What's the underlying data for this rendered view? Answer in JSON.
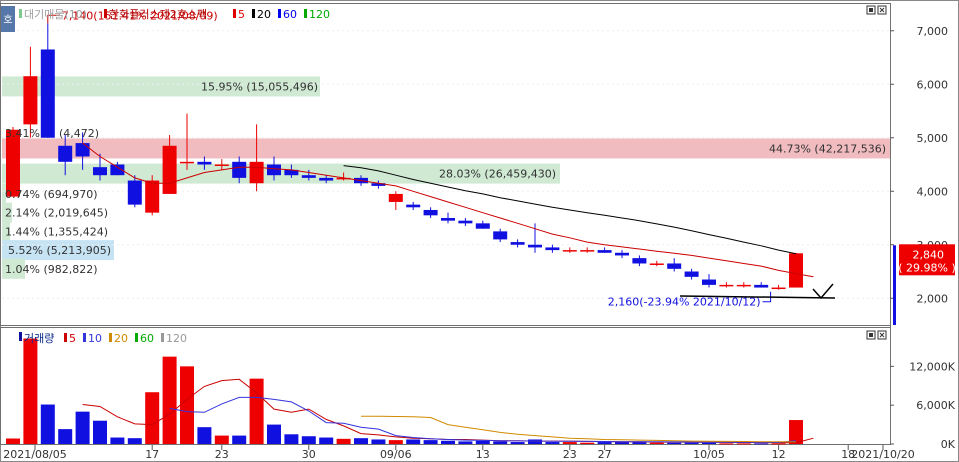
{
  "price_panel": {
    "legend": {
      "volume_profile_label": "대기매물(10)",
      "stock_name": "한화플러스제2호스팩",
      "ma": [
        {
          "label": "5",
          "color": "#e00000"
        },
        {
          "label": "20",
          "color": "#000000"
        },
        {
          "label": "60",
          "color": "#0000ee"
        },
        {
          "label": "120",
          "color": "#00aa00"
        }
      ]
    },
    "side_tab": "호"
  },
  "volume_panel": {
    "legend": {
      "title": "거래량",
      "ma": [
        {
          "label": "5",
          "color": "#cc0000"
        },
        {
          "label": "10",
          "color": "#3333dd"
        },
        {
          "label": "20",
          "color": "#d08a00"
        },
        {
          "label": "60",
          "color": "#00aa00"
        },
        {
          "label": "120",
          "color": "#999999"
        }
      ]
    }
  },
  "chart_data": {
    "type": "candlestick",
    "currency_unit": "KRW",
    "up_color": "#ee0000",
    "down_color": "#1010e0",
    "price_axis": {
      "ticks": [
        "7,000",
        "6,000",
        "5,000",
        "4,000",
        "3,000",
        "2,000"
      ],
      "tick_values": [
        7000,
        6000,
        5000,
        4000,
        3000,
        2000
      ],
      "range": [
        1500,
        7500
      ]
    },
    "volume_axis": {
      "ticks": [
        "12,000K",
        "6,000K",
        "0K"
      ],
      "tick_values": [
        12000,
        6000,
        0
      ],
      "range": [
        0,
        17000
      ]
    },
    "x_labels": [
      {
        "text": "2021/08/05",
        "index": 0
      },
      {
        "text": "17",
        "index": 8
      },
      {
        "text": "23",
        "index": 12
      },
      {
        "text": "30",
        "index": 17
      },
      {
        "text": "09/06",
        "index": 22
      },
      {
        "text": "13",
        "index": 27
      },
      {
        "text": "23",
        "index": 32
      },
      {
        "text": "27",
        "index": 34
      },
      {
        "text": "10/05",
        "index": 40
      },
      {
        "text": "12",
        "index": 44
      },
      {
        "text": "18",
        "index": 48
      },
      {
        "text": "2021/10/20",
        "index": 50
      }
    ],
    "candles": [
      {
        "o": 3900,
        "h": 5200,
        "l": 3900,
        "c": 5150,
        "v": 850
      },
      {
        "o": 5250,
        "h": 6700,
        "l": 5000,
        "c": 6150,
        "v": 16300
      },
      {
        "o": 6650,
        "h": 7140,
        "l": 5000,
        "c": 5000,
        "v": 6100
      },
      {
        "o": 4850,
        "h": 5050,
        "l": 4300,
        "c": 4550,
        "v": 2300
      },
      {
        "o": 4900,
        "h": 5100,
        "l": 4400,
        "c": 4650,
        "v": 5000
      },
      {
        "o": 4450,
        "h": 4700,
        "l": 4200,
        "c": 4300,
        "v": 3600
      },
      {
        "o": 4500,
        "h": 4550,
        "l": 4300,
        "c": 4300,
        "v": 1000
      },
      {
        "o": 4200,
        "h": 4300,
        "l": 3700,
        "c": 3750,
        "v": 900
      },
      {
        "o": 3600,
        "h": 4300,
        "l": 3550,
        "c": 4200,
        "v": 8000
      },
      {
        "o": 3950,
        "h": 5050,
        "l": 3950,
        "c": 4850,
        "v": 13500
      },
      {
        "o": 4550,
        "h": 5450,
        "l": 4400,
        "c": 4550,
        "v": 12000
      },
      {
        "o": 4550,
        "h": 4650,
        "l": 4400,
        "c": 4500,
        "v": 2600
      },
      {
        "o": 4500,
        "h": 4600,
        "l": 4400,
        "c": 4500,
        "v": 1300
      },
      {
        "o": 4550,
        "h": 4650,
        "l": 4150,
        "c": 4250,
        "v": 1300
      },
      {
        "o": 4150,
        "h": 5250,
        "l": 4000,
        "c": 4550,
        "v": 10100
      },
      {
        "o": 4500,
        "h": 4650,
        "l": 4200,
        "c": 4300,
        "v": 3000
      },
      {
        "o": 4400,
        "h": 4500,
        "l": 4250,
        "c": 4300,
        "v": 1500
      },
      {
        "o": 4300,
        "h": 4400,
        "l": 4200,
        "c": 4250,
        "v": 1200
      },
      {
        "o": 4250,
        "h": 4300,
        "l": 4150,
        "c": 4200,
        "v": 1000
      },
      {
        "o": 4250,
        "h": 4350,
        "l": 4200,
        "c": 4250,
        "v": 800
      },
      {
        "o": 4250,
        "h": 4300,
        "l": 4100,
        "c": 4150,
        "v": 900
      },
      {
        "o": 4150,
        "h": 4200,
        "l": 4050,
        "c": 4100,
        "v": 700
      },
      {
        "o": 3800,
        "h": 4000,
        "l": 3650,
        "c": 3950,
        "v": 600
      },
      {
        "o": 3750,
        "h": 3800,
        "l": 3650,
        "c": 3700,
        "v": 700
      },
      {
        "o": 3650,
        "h": 3700,
        "l": 3500,
        "c": 3550,
        "v": 600
      },
      {
        "o": 3500,
        "h": 3600,
        "l": 3400,
        "c": 3450,
        "v": 500
      },
      {
        "o": 3450,
        "h": 3500,
        "l": 3350,
        "c": 3400,
        "v": 400
      },
      {
        "o": 3400,
        "h": 3450,
        "l": 3300,
        "c": 3300,
        "v": 500
      },
      {
        "o": 3250,
        "h": 3300,
        "l": 3050,
        "c": 3100,
        "v": 400
      },
      {
        "o": 3050,
        "h": 3100,
        "l": 2950,
        "c": 3000,
        "v": 300
      },
      {
        "o": 3000,
        "h": 3400,
        "l": 2850,
        "c": 2950,
        "v": 700
      },
      {
        "o": 2950,
        "h": 3000,
        "l": 2850,
        "c": 2900,
        "v": 300
      },
      {
        "o": 2900,
        "h": 2950,
        "l": 2850,
        "c": 2900,
        "v": 300
      },
      {
        "o": 2900,
        "h": 2950,
        "l": 2850,
        "c": 2900,
        "v": 200
      },
      {
        "o": 2900,
        "h": 2950,
        "l": 2850,
        "c": 2850,
        "v": 300
      },
      {
        "o": 2850,
        "h": 2900,
        "l": 2750,
        "c": 2800,
        "v": 300
      },
      {
        "o": 2750,
        "h": 2800,
        "l": 2600,
        "c": 2650,
        "v": 300
      },
      {
        "o": 2650,
        "h": 2700,
        "l": 2600,
        "c": 2650,
        "v": 200
      },
      {
        "o": 2650,
        "h": 2750,
        "l": 2500,
        "c": 2550,
        "v": 200
      },
      {
        "o": 2500,
        "h": 2550,
        "l": 2350,
        "c": 2400,
        "v": 200
      },
      {
        "o": 2350,
        "h": 2450,
        "l": 2200,
        "c": 2250,
        "v": 200
      },
      {
        "o": 2250,
        "h": 2300,
        "l": 2200,
        "c": 2250,
        "v": 100
      },
      {
        "o": 2250,
        "h": 2300,
        "l": 2200,
        "c": 2250,
        "v": 100
      },
      {
        "o": 2250,
        "h": 2300,
        "l": 2200,
        "c": 2200,
        "v": 100
      },
      {
        "o": 2200,
        "h": 2250,
        "l": 2160,
        "c": 2200,
        "v": 100
      },
      {
        "o": 2200,
        "h": 2850,
        "l": 2200,
        "c": 2840,
        "v": 3700
      }
    ],
    "ma_lines": [
      {
        "label": "5",
        "color": "#cc0000",
        "start": 4,
        "values": [
          4900,
          4650,
          4450,
          4250,
          4150,
          4150,
          4250,
          4350,
          4400,
          4450,
          4450,
          4420,
          4400,
          4350,
          4300,
          4250,
          4200,
          4150,
          4100,
          4000,
          3900,
          3800,
          3700,
          3600,
          3500,
          3400,
          3300,
          3200,
          3130,
          3050,
          3000,
          2960,
          2920,
          2880,
          2840,
          2800,
          2750,
          2700,
          2650,
          2600,
          2520,
          2460,
          2400
        ]
      },
      {
        "label": "20",
        "color": "#000000",
        "start": 19,
        "values": [
          4480,
          4440,
          4380,
          4300,
          4220,
          4150,
          4080,
          4010,
          3950,
          3880,
          3820,
          3760,
          3700,
          3650,
          3600,
          3550,
          3500,
          3450,
          3390,
          3330,
          3260,
          3190,
          3120,
          3050,
          2980,
          2900,
          2830
        ]
      }
    ],
    "volume_ma_lines": [
      {
        "label": "5",
        "color": "#cc0000",
        "start": 4,
        "values": [
          6100,
          5800,
          4200,
          3100,
          3000,
          4600,
          6900,
          8900,
          9800,
          10000,
          7900,
          5400,
          4900,
          5400,
          3800,
          2800,
          1600,
          1400,
          1100,
          900,
          800,
          700,
          700,
          600,
          500,
          500,
          450,
          450,
          450,
          400,
          380,
          360,
          340,
          300,
          300,
          280,
          260,
          240,
          230,
          220,
          200,
          200,
          900
        ]
      },
      {
        "label": "10",
        "color": "#3333dd",
        "start": 9,
        "values": [
          5500,
          5000,
          4900,
          6200,
          7200,
          7200,
          6900,
          6500,
          5100,
          3300,
          3200,
          2600,
          2300,
          1300,
          1000,
          800,
          700,
          600,
          550,
          500,
          480,
          460,
          440,
          420,
          400,
          380,
          360,
          350,
          340,
          320,
          300,
          280,
          260,
          250,
          240,
          230,
          500
        ]
      },
      {
        "label": "20",
        "color": "#d08a00",
        "start": 20,
        "values": [
          4300,
          4300,
          4250,
          4200,
          4100,
          3000,
          2600,
          2200,
          1800,
          1500,
          1300,
          1100,
          900,
          800,
          700,
          650,
          600,
          550,
          500,
          450,
          420,
          400,
          380,
          360,
          340,
          320
        ]
      }
    ],
    "annotations": {
      "high_label": "7,140(151.41% 2021/08/09)",
      "low_label": "2,160(-23.94% 2021/10/12)",
      "last_price": "2,840",
      "last_change": "( 29.98% )",
      "price_zones": [
        {
          "text": "15.95% (15,055,496)",
          "price": 5960
        },
        {
          "text": "44.73% (42,217,536)",
          "price": 4800
        },
        {
          "text": "28.03% (26,459,430)",
          "price": 4330
        },
        {
          "text": "0.74% (694,970)",
          "price": 3950
        },
        {
          "text": "2.14% (2,019,645)",
          "price": 3600
        },
        {
          "text": "1.44% (1,355,424)",
          "price": 3250
        },
        {
          "text": "5.52% (5,213,905)",
          "price": 2900
        },
        {
          "text": "1.04% (982,822)",
          "price": 2550
        }
      ],
      "partial_zone_texts": [
        "3.41%",
        "(4,472)"
      ]
    }
  }
}
